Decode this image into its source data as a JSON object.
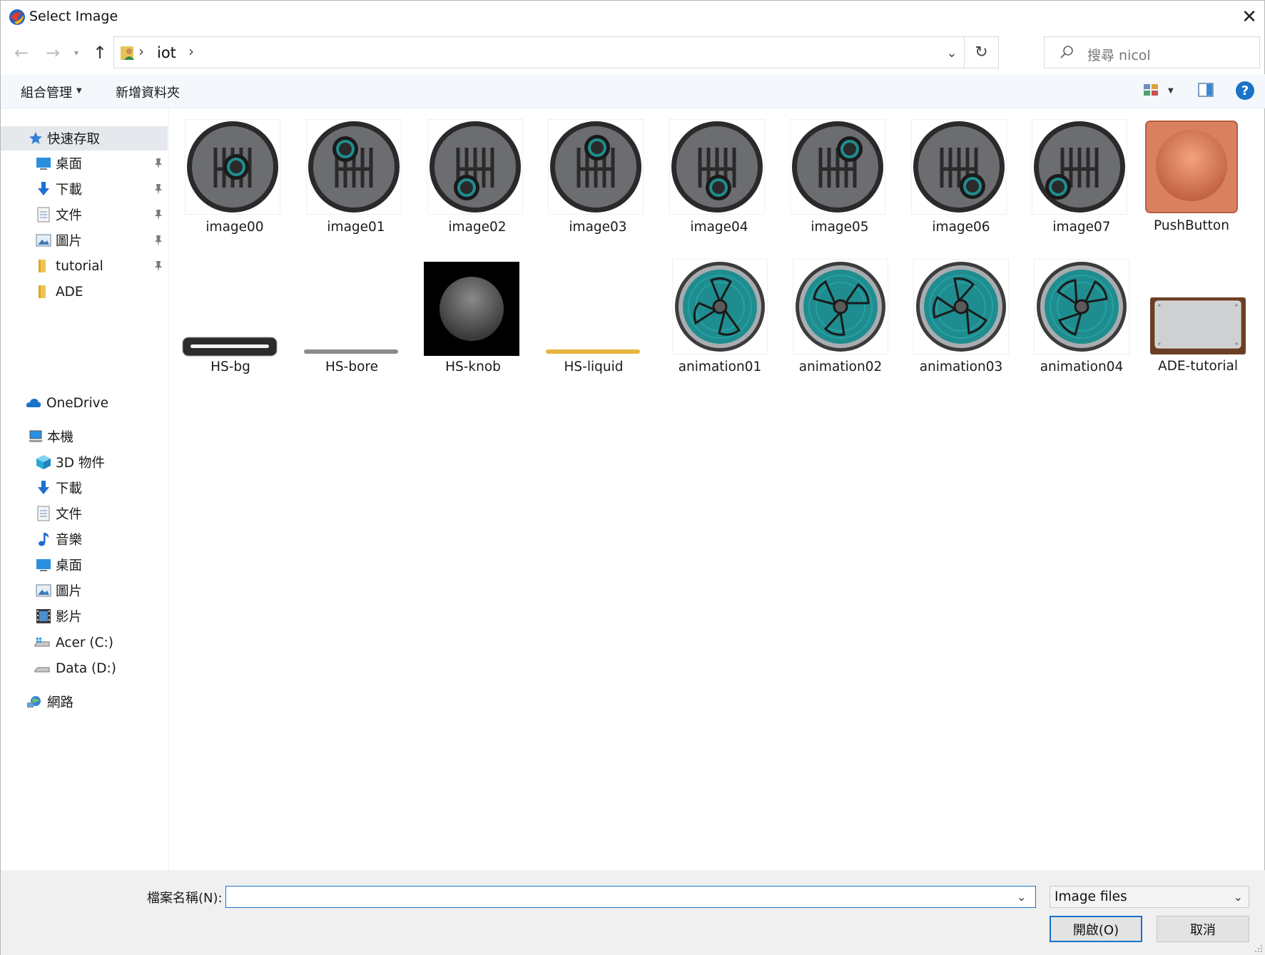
{
  "window": {
    "title": "Select Image",
    "close_glyph": "✕"
  },
  "nav": {
    "back_glyph": "←",
    "forward_glyph": "→",
    "recent_glyph": "▾",
    "up_glyph": "↑",
    "separator": "›",
    "breadcrumb": [
      "iot"
    ],
    "dropdown_glyph": "⌄",
    "refresh_glyph": "↻",
    "search_placeholder": "搜尋 nicol"
  },
  "commands": {
    "organize": "組合管理",
    "new_folder": "新增資料夾",
    "caret": "▼",
    "help": "?"
  },
  "sidebar": {
    "quick_access": [
      {
        "label": "快速存取",
        "icon": "star-icon",
        "pinned": false
      },
      {
        "label": "桌面",
        "icon": "desktop-icon",
        "pinned": true
      },
      {
        "label": "下載",
        "icon": "download-icon",
        "pinned": true
      },
      {
        "label": "文件",
        "icon": "document-icon",
        "pinned": true
      },
      {
        "label": "圖片",
        "icon": "pictures-icon",
        "pinned": true
      },
      {
        "label": "tutorial",
        "icon": "folder-icon",
        "pinned": true
      },
      {
        "label": "ADE",
        "icon": "folder-icon",
        "pinned": false
      }
    ],
    "onedrive": {
      "label": "OneDrive",
      "icon": "cloud-icon"
    },
    "this_pc": [
      {
        "label": "本機",
        "icon": "computer-icon"
      },
      {
        "label": "3D 物件",
        "icon": "cube-icon"
      },
      {
        "label": "下載",
        "icon": "download-icon"
      },
      {
        "label": "文件",
        "icon": "document-icon"
      },
      {
        "label": "音樂",
        "icon": "music-icon"
      },
      {
        "label": "桌面",
        "icon": "desktop-icon"
      },
      {
        "label": "圖片",
        "icon": "pictures-icon"
      },
      {
        "label": "影片",
        "icon": "video-icon"
      },
      {
        "label": "Acer (C:)",
        "icon": "drive-c-icon"
      },
      {
        "label": "Data (D:)",
        "icon": "drive-d-icon"
      }
    ],
    "network": {
      "label": "網路",
      "icon": "network-icon"
    }
  },
  "files": [
    {
      "name": "image00",
      "kind": "gear-knob",
      "knob_pos": "center"
    },
    {
      "name": "image01",
      "kind": "gear-knob",
      "knob_pos": "top-left"
    },
    {
      "name": "image02",
      "kind": "gear-knob",
      "knob_pos": "bottom-left"
    },
    {
      "name": "image03",
      "kind": "gear-knob",
      "knob_pos": "top-center"
    },
    {
      "name": "image04",
      "kind": "gear-knob",
      "knob_pos": "bottom-center"
    },
    {
      "name": "image05",
      "kind": "gear-knob",
      "knob_pos": "top-right"
    },
    {
      "name": "image06",
      "kind": "gear-knob",
      "knob_pos": "bottom-right"
    },
    {
      "name": "image07",
      "kind": "gear-knob",
      "knob_pos": "bottom-far-left"
    },
    {
      "name": "PushButton",
      "kind": "push-button"
    },
    {
      "name": "HS-bg",
      "kind": "slider-bg"
    },
    {
      "name": "HS-bore",
      "kind": "slider-bore"
    },
    {
      "name": "HS-knob",
      "kind": "slider-knob"
    },
    {
      "name": "HS-liquid",
      "kind": "slider-liquid"
    },
    {
      "name": "animation01",
      "kind": "fan"
    },
    {
      "name": "animation02",
      "kind": "fan"
    },
    {
      "name": "animation03",
      "kind": "fan"
    },
    {
      "name": "animation04",
      "kind": "fan"
    },
    {
      "name": "ADE-tutorial",
      "kind": "panel"
    }
  ],
  "footer": {
    "filename_label": "檔案名稱(N):",
    "filename_value": "",
    "filetype": "Image files",
    "caret": "⌄",
    "open": "開啟(O)",
    "cancel": "取消"
  },
  "colors": {
    "accent": "#1a73c8",
    "teal": "#1f8d8f",
    "push_button": "#d9805f",
    "liquid": "#e5b53c"
  }
}
